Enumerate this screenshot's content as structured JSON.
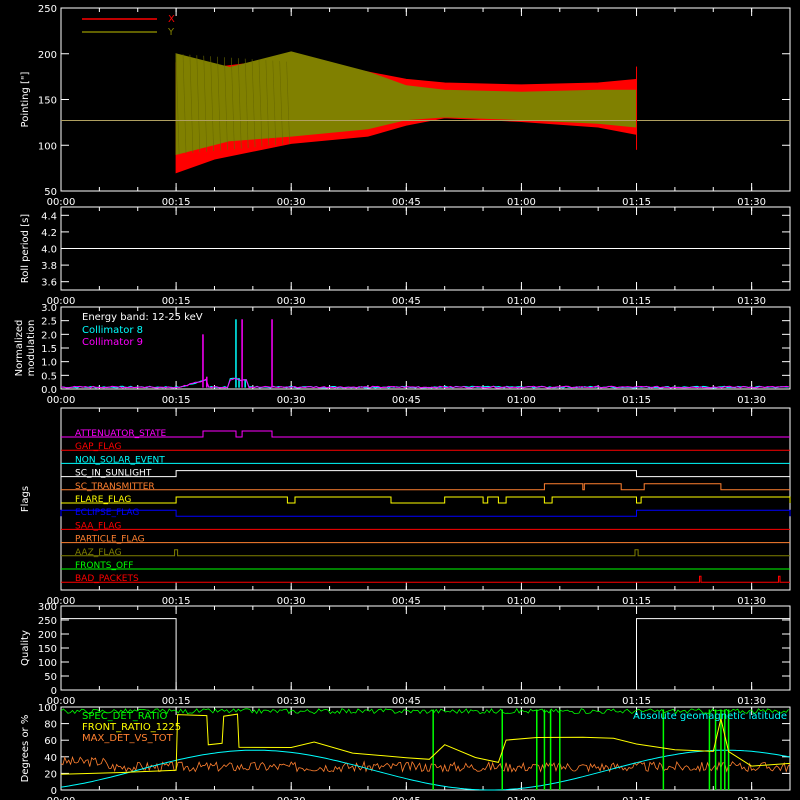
{
  "chart_data": [
    {
      "panel": "pointing",
      "type": "area",
      "ylabel": "Pointing [\"]",
      "ylim": [
        50,
        250
      ],
      "yticks": [
        50,
        100,
        150,
        200,
        250
      ],
      "xlim": [
        0,
        95
      ],
      "series": [
        {
          "name": "X",
          "color": "#ff0000",
          "upper": [
            [
              15,
              190
            ],
            [
              20,
              185
            ],
            [
              30,
              195
            ],
            [
              40,
              180
            ],
            [
              45,
              172
            ],
            [
              50,
              168
            ],
            [
              60,
              166
            ],
            [
              70,
              168
            ],
            [
              75,
              172
            ]
          ],
          "lower": [
            [
              15,
              70
            ],
            [
              20,
              85
            ],
            [
              30,
              102
            ],
            [
              40,
              110
            ],
            [
              45,
              122
            ],
            [
              50,
              130
            ],
            [
              60,
              126
            ],
            [
              70,
              120
            ],
            [
              75,
              112
            ]
          ]
        },
        {
          "name": "Y",
          "color": "#808000",
          "upper": [
            [
              15,
              200
            ],
            [
              22,
              185
            ],
            [
              30,
              202
            ],
            [
              40,
              180
            ],
            [
              45,
              165
            ],
            [
              50,
              160
            ],
            [
              60,
              158
            ],
            [
              70,
              160
            ],
            [
              75,
              160
            ]
          ],
          "lower": [
            [
              15,
              90
            ],
            [
              22,
              105
            ],
            [
              30,
              110
            ],
            [
              40,
              118
            ],
            [
              45,
              128
            ],
            [
              50,
              131
            ],
            [
              60,
              128
            ],
            [
              70,
              124
            ],
            [
              75,
              120
            ]
          ]
        }
      ],
      "reference_line": 127
    },
    {
      "panel": "roll",
      "type": "line",
      "ylabel": "Roll period [s]",
      "ylim": [
        3.5,
        4.5
      ],
      "yticks": [
        3.6,
        3.8,
        4.0,
        4.2,
        4.4
      ],
      "xlim": [
        0,
        95
      ],
      "value": 4.0
    },
    {
      "panel": "modulation",
      "type": "line",
      "ylabel": "Normalized modulation",
      "ylim": [
        0,
        3.0
      ],
      "yticks": [
        0.0,
        0.5,
        1.0,
        1.5,
        2.0,
        2.5,
        3.0
      ],
      "xlim": [
        0,
        95
      ],
      "annotation": "Energy band: 12-25 keV",
      "series": [
        {
          "name": "Collimator 8",
          "color": "#00ffff",
          "spikes": [
            [
              22.8,
              2.55
            ],
            [
              23.2,
              0.4
            ],
            [
              24.0,
              0.35
            ]
          ]
        },
        {
          "name": "Collimator 9",
          "color": "#ff00ff",
          "spikes": [
            [
              18.5,
              2.0
            ],
            [
              19.0,
              0.45
            ],
            [
              23.6,
              2.55
            ],
            [
              27.5,
              2.55
            ]
          ]
        }
      ]
    },
    {
      "panel": "flags",
      "type": "line",
      "ylabel": "Flags",
      "xlim": [
        0,
        95
      ],
      "flags": [
        {
          "name": "ATTENUATOR_STATE",
          "color": "#ff00ff",
          "segments": [
            [
              18.5,
              22.8
            ],
            [
              23.6,
              27.5
            ]
          ]
        },
        {
          "name": "GAP_FLAG",
          "color": "#ff0000",
          "segments": []
        },
        {
          "name": "NON_SOLAR_EVENT",
          "color": "#00ffff",
          "segments": []
        },
        {
          "name": "SC_IN_SUNLIGHT",
          "color": "#ffffff",
          "segments": [
            [
              15,
              75
            ]
          ]
        },
        {
          "name": "SC_TRANSMITTER",
          "color": "#ff8030",
          "segments": [
            [
              63,
              68
            ],
            [
              68.2,
              73
            ],
            [
              76,
              86
            ]
          ]
        },
        {
          "name": "FLARE_FLAG",
          "color": "#ffff00",
          "segments": [
            [
              15,
              29.5
            ],
            [
              30.5,
              43
            ],
            [
              50,
              55
            ],
            [
              55.6,
              57
            ],
            [
              58,
              63
            ],
            [
              64,
              75
            ],
            [
              75.6,
              95
            ]
          ]
        },
        {
          "name": "ECLIPSE_FLAG",
          "color": "#0000ff",
          "segments": [
            [
              0,
              15
            ],
            [
              75,
              95
            ]
          ]
        },
        {
          "name": "SAA_FLAG",
          "color": "#ff0000",
          "segments": []
        },
        {
          "name": "PARTICLE_FLAG",
          "color": "#ff8030",
          "segments": []
        },
        {
          "name": "AAZ_FLAG",
          "color": "#808000",
          "segments": [
            [
              14.8,
              15.2
            ],
            [
              74.8,
              75.2
            ]
          ]
        },
        {
          "name": "FRONTS_OFF",
          "color": "#00ff00",
          "segments": []
        },
        {
          "name": "BAD_PACKETS",
          "color": "#ff0000",
          "segments": [
            [
              83.2,
              83.4
            ],
            [
              93.5,
              93.7
            ]
          ]
        }
      ]
    },
    {
      "panel": "quality",
      "type": "line",
      "ylabel": "Quality",
      "ylim": [
        0,
        300
      ],
      "yticks": [
        0,
        50,
        100,
        150,
        200,
        250,
        300
      ],
      "xlim": [
        0,
        95
      ],
      "steps": [
        [
          0,
          255
        ],
        [
          15,
          255
        ],
        [
          15,
          0
        ],
        [
          75,
          0
        ],
        [
          75,
          255
        ],
        [
          95,
          255
        ]
      ]
    },
    {
      "panel": "misc",
      "type": "line",
      "ylabel": "Degrees or %",
      "ylim": [
        0,
        100
      ],
      "yticks": [
        0,
        20,
        40,
        60,
        80,
        100
      ],
      "xlim": [
        0,
        95
      ],
      "series": [
        {
          "name": "SPEC_DET_RATIO",
          "color": "#00ff00"
        },
        {
          "name": "FRONT_RATIO_1225",
          "color": "#ffff00"
        },
        {
          "name": "MAX_DET_VS_TOT",
          "color": "#ff8030"
        },
        {
          "name": "Absolute geomagnetic latitude",
          "color": "#00ffff"
        }
      ]
    }
  ],
  "xaxis": {
    "ticks": [
      0,
      15,
      30,
      45,
      60,
      75,
      90
    ],
    "tick_labels": [
      "00:00",
      "00:15",
      "00:30",
      "00:45",
      "01:00",
      "01:15",
      "01:30"
    ]
  }
}
